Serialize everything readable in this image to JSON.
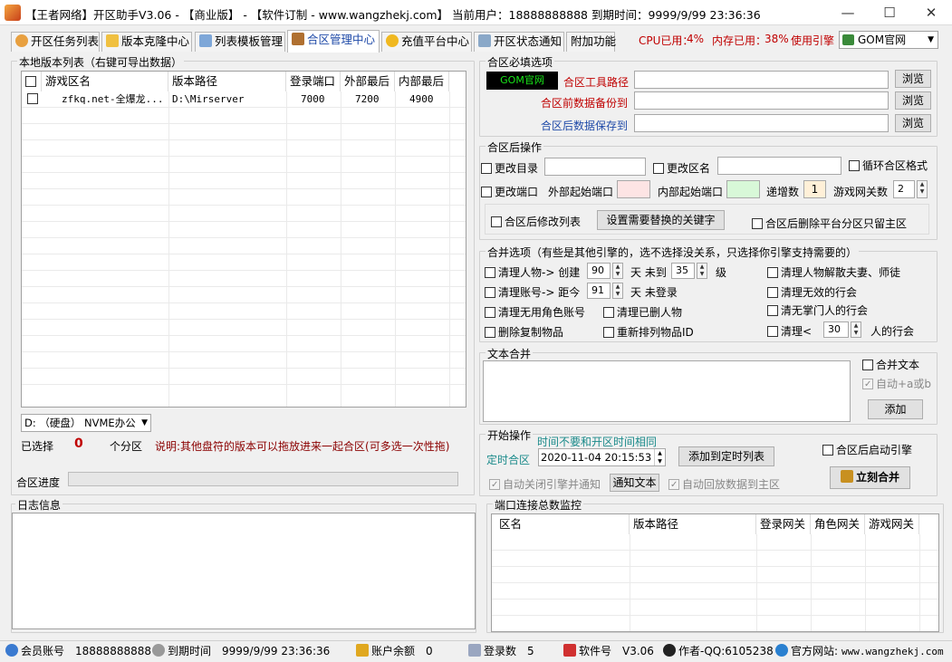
{
  "window": {
    "title": "【王者网络】开区助手V3.06 - 【商业版】 - 【软件订制 - www.wangzhekj.com】 当前用户：18888888888 到期时间：9999/9/99 23:36:36",
    "minimize": "—",
    "maximize": "☐",
    "close": "✕"
  },
  "tabs": [
    {
      "label": "开区任务列表",
      "icon": "clock-icon"
    },
    {
      "label": "版本克隆中心",
      "icon": "folder-icon"
    },
    {
      "label": "列表模板管理",
      "icon": "list-icon"
    },
    {
      "label": "合区管理中心",
      "icon": "database-icon"
    },
    {
      "label": "充值平台中心",
      "icon": "coin-icon"
    },
    {
      "label": "开区状态通知",
      "icon": "document-icon"
    },
    {
      "label": "附加功能",
      "icon": ""
    }
  ],
  "status": {
    "cpu_label": "CPU已用：",
    "cpu_value": "4%",
    "mem_label": "内存已用：",
    "mem_value": "38%",
    "engine_label": "使用引擎",
    "engine_value": "GOM官网"
  },
  "local_list": {
    "title": "本地版本列表（右键可导出数据）",
    "columns": [
      "游戏区名",
      "版本路径",
      "登录端口",
      "外部最后",
      "内部最后"
    ],
    "rows": [
      {
        "name": "zfkq.net-全爆龙...",
        "path": "D:\\Mirserver",
        "login": "7000",
        "external": "7200",
        "internal": "4900"
      }
    ],
    "drive": "D: （硬盘） NVME办公",
    "selected_label": "已选择",
    "selected_count": "0",
    "selected_unit": "个分区",
    "hint": "说明:其他盘符的版本可以拖放进来一起合区(可多选一次性拖)",
    "progress_label": "合区进度",
    "progress": 0
  },
  "required": {
    "title": "合区必填选项",
    "badge": "GOM官网",
    "tool_path_label": "合区工具路径",
    "backup_label": "合区前数据备份到",
    "save_label": "合区后数据保存到",
    "tool_path": "",
    "backup_path": "",
    "save_path": "",
    "browse": "浏览"
  },
  "after_ops": {
    "title": "合区后操作",
    "change_dir": "更改目录",
    "change_name": "更改区名",
    "loop_format": "循环合区格式",
    "change_port": "更改端口",
    "ext_start_port": "外部起始端口",
    "int_start_port": "内部起始端口",
    "increment_label": "递增数",
    "increment_value": "1",
    "gateway_label": "游戏网关数",
    "gateway_value": "2",
    "modify_list": "合区后修改列表",
    "set_keywords": "设置需要替换的关键字",
    "delete_platform": "合区后删除平台分区只留主区"
  },
  "merge_opts": {
    "title": "合并选项（有些是其他引擎的，选不选择没关系，只选择你引擎支持需要的）",
    "clear_chars": "清理人物-> 创建",
    "clear_chars_days": "90",
    "clear_chars_days_unit": "天 未到",
    "clear_chars_level": "35",
    "clear_chars_level_unit": "级",
    "dissolve": "清理人物解散夫妻、师徒",
    "clear_accounts": "清理账号-> 距今",
    "clear_accounts_days": "91",
    "clear_accounts_unit": "天 未登录",
    "clear_invalid_guild": "清理无效的行会",
    "clear_unused_chars": "清理无用角色账号",
    "clear_deleted_chars": "清理已删人物",
    "clear_leaderless": "清无掌门人的行会",
    "delete_dup_items": "删除复制物品",
    "reorder_item_ids": "重新排列物品ID",
    "clear_small_guild": "清理<",
    "clear_small_guild_value": "30",
    "clear_small_guild_unit": "人的行会"
  },
  "text_merge": {
    "title": "文本合并",
    "merge_text": "合并文本",
    "auto_ab": "自动+a或b",
    "add": "添加"
  },
  "start_ops": {
    "title": "开始操作",
    "time_hint": "时间不要和开区时间相同",
    "timed_label": "定时合区",
    "datetime": "2020-11-04 20:15:53",
    "add_timed": "添加到定时列表",
    "start_engine": "合区后启动引擎",
    "auto_close": "自动关闭引擎并通知",
    "notify_text": "通知文本",
    "auto_rollback": "自动回放数据到主区",
    "merge_now": "立刻合并"
  },
  "log": {
    "title": "日志信息"
  },
  "port_monitor": {
    "title": "端口连接总数监控",
    "columns": [
      "区名",
      "版本路径",
      "登录网关",
      "角色网关",
      "游戏网关"
    ]
  },
  "statusbar": {
    "account_label": "会员账号",
    "account": "18888888888",
    "expire_label": "到期时间",
    "expire": "9999/9/99 23:36:36",
    "balance_label": "账户余额",
    "balance": "0",
    "logins_label": "登录数",
    "logins": "5",
    "version_label": "软件号",
    "version": "V3.06",
    "author_label": "作者-QQ:6105238",
    "site_label": "官方网站:",
    "site": "www.wangzhekj.com"
  },
  "colors": {
    "accent": "#1f4aa8",
    "warning": "#c00000",
    "badge_bg": "#000000",
    "badge_fg": "#19e619",
    "ext_port_bg": "#fde4e4",
    "int_port_bg": "#d8f8d8",
    "increment_bg": "#fff0d8"
  }
}
